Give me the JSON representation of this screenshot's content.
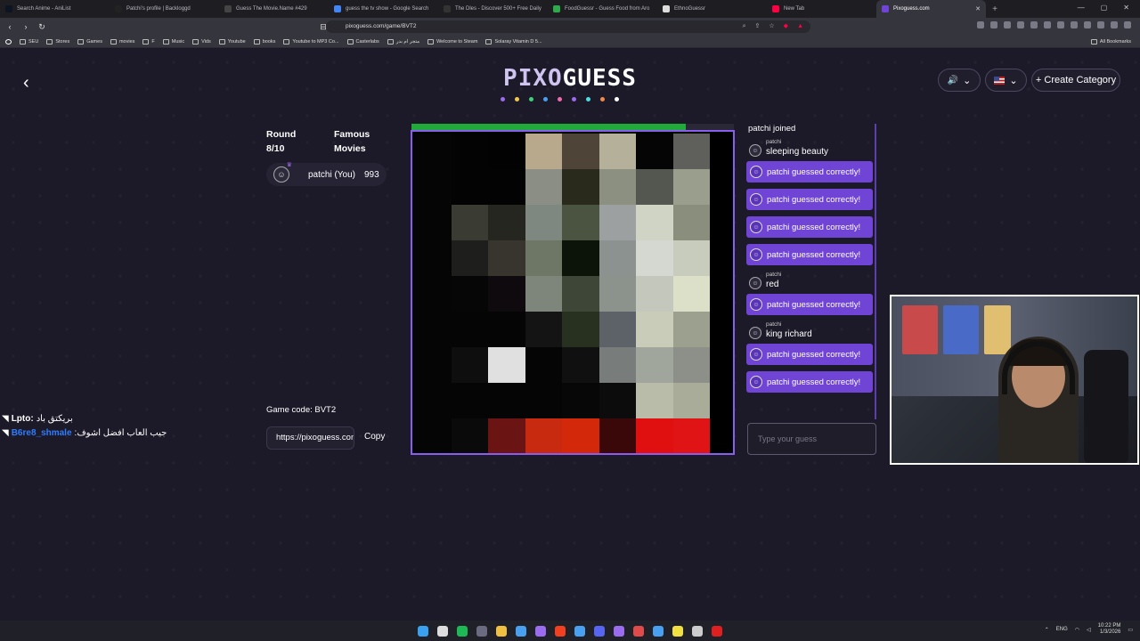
{
  "browser": {
    "tabs": [
      {
        "title": "Search Anime - AniList",
        "icon": "anilist-icon",
        "color": "#0b1622"
      },
      {
        "title": "Patchi's profile | Backloggd",
        "icon": "backloggd-icon",
        "color": "#222"
      },
      {
        "title": "Guess The Movie.Name #429",
        "icon": "movie-icon",
        "color": "#444"
      },
      {
        "title": "guess the tv show - Google Search",
        "icon": "google-icon",
        "color": "#4285f4"
      },
      {
        "title": "The Dles - Discover 500+ Free Daily",
        "icon": "dles-icon",
        "color": "#333"
      },
      {
        "title": "FoodGuessr - Guess Food from Aro",
        "icon": "foodguessr-icon",
        "color": "#2eaa4b"
      },
      {
        "title": "EthnoGuessr",
        "icon": "ethnoguessr-icon",
        "color": "#ddd"
      },
      {
        "title": "New Tab",
        "icon": "brave-icon",
        "color": "#f04"
      },
      {
        "title": "Pixoguess.com",
        "icon": "pixoguess-icon",
        "color": "#7045d6",
        "active": true
      }
    ],
    "new_tab_glyph": "+",
    "window_controls": [
      "—",
      "▢",
      "✕"
    ],
    "url": "pixoguess.com/game/BVT2",
    "bookmarks": [
      "SEU",
      "Stores",
      "Games",
      "movies",
      "F",
      "Music",
      "Vids",
      "Youtube",
      "books",
      "Youtube to MP3 Co...",
      "Casterlabs",
      "متجر ام بدر",
      "Welcome to Steam",
      "Solaray Vitamin D 5..."
    ],
    "all_bookmarks": "All Bookmarks"
  },
  "page": {
    "back_glyph": "‹",
    "logo_part1": "PIXO",
    "logo_part2": "GUESS",
    "logo_dots": [
      "#9b6cf0",
      "#f0c84a",
      "#3ed07a",
      "#4aa0f0",
      "#f06ab0",
      "#9b6cf0",
      "#4ae0e0",
      "#f08a4a",
      "#ffffff"
    ],
    "sound_glyph": "🔊",
    "chevron": "⌄",
    "create_category_label": "+ Create Category",
    "round_label": "Round",
    "round_value": "8/10",
    "category_name": "Famous Movies",
    "player": {
      "name": "patchi (You)",
      "score": "993",
      "crown": "♛",
      "avatar_glyph": "☺"
    },
    "game_code_label": "Game code: BVT2",
    "share_link": "https://pixoguess.com/game/BVT2",
    "copy_label": "Copy",
    "timer_progress_fraction": 0.85,
    "pixel_colors": [
      [
        "#050505",
        "#030303",
        "#020202",
        "#b8a88c",
        "#4e4538",
        "#b4b09a",
        "#050505",
        "#5f605c"
      ],
      [
        "#050505",
        "#030303",
        "#030303",
        "#8a8e84",
        "#2a2a1c",
        "#8c9080",
        "#545650",
        "#9a9e8c"
      ],
      [
        "#050505",
        "#3a3c34",
        "#262620",
        "#7e8880",
        "#4a5440",
        "#9ca0a0",
        "#d0d4c4",
        "#8a8e7c"
      ],
      [
        "#050505",
        "#1e1e1c",
        "#38342e",
        "#6e7666",
        "#0c140a",
        "#8c9290",
        "#d4d8d0",
        "#c8ccbc"
      ],
      [
        "#050505",
        "#060606",
        "#0e0a0e",
        "#7e867c",
        "#3e4638",
        "#8c928c",
        "#c4c8bc",
        "#dce0c8"
      ],
      [
        "#050505",
        "#050505",
        "#050505",
        "#141414",
        "#283020",
        "#5c6268",
        "#c8ccb8",
        "#9ca08e"
      ],
      [
        "#050505",
        "#0e0e0e",
        "#e0e0e0",
        "#050505",
        "#101010",
        "#787c7a",
        "#a0a69c",
        "#8c9088"
      ],
      [
        "#050505",
        "#050505",
        "#050505",
        "#050505",
        "#070707",
        "#0c0c0c",
        "#b8bca8",
        "#a8ac98"
      ],
      [
        "#050505",
        "#0a0a0a",
        "#6a1414",
        "#c82a10",
        "#d4280a",
        "#3a0808",
        "#e01010",
        "#e01414"
      ]
    ],
    "chat": {
      "system_message": "patchi joined",
      "correct_text": "patchi guessed correctly!",
      "messages": [
        {
          "type": "msg",
          "user": "patchi",
          "text": "sleeping beauty"
        },
        {
          "type": "correct"
        },
        {
          "type": "correct"
        },
        {
          "type": "correct"
        },
        {
          "type": "correct"
        },
        {
          "type": "msg",
          "user": "patchi",
          "text": "red"
        },
        {
          "type": "correct"
        },
        {
          "type": "msg",
          "user": "patchi",
          "text": "king richard"
        },
        {
          "type": "correct"
        },
        {
          "type": "correct"
        }
      ],
      "input_placeholder": "Type your guess"
    }
  },
  "stream_chat": [
    {
      "user": "Lpto:",
      "text": "بريكتق باد",
      "color": "#ffffff"
    },
    {
      "user": "B6re8_shmale",
      "text": ":جيب العاب افضل اشوف",
      "color": "#2e7cff"
    }
  ],
  "taskbar": {
    "icons": [
      "#3aa0f0",
      "#dddddd",
      "#1db954",
      "#6a6a80",
      "#f0c040",
      "#4aa0f0",
      "#9b6cf0",
      "#f04020",
      "#4aa0f0",
      "#5865f2",
      "#9b6cf0",
      "#e04a4a",
      "#4aa0f0",
      "#f0e040",
      "#cccccc",
      "#e02020"
    ],
    "lang": "ENG",
    "time": "10:22 PM",
    "date": "1/3/2026"
  }
}
